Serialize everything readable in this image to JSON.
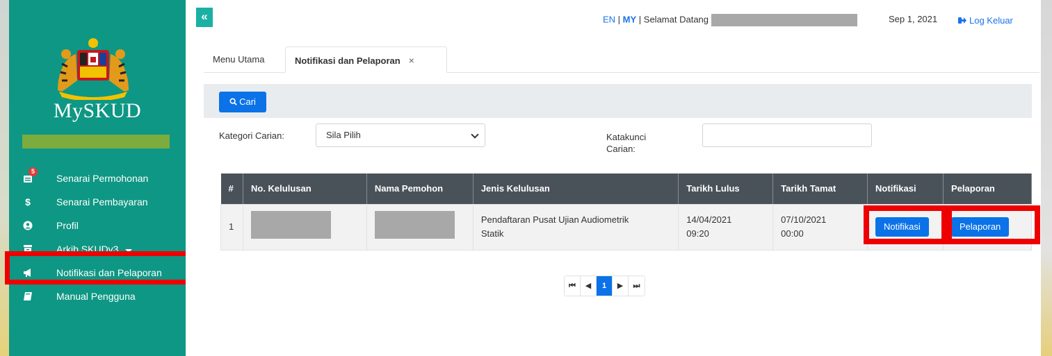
{
  "sidebar": {
    "brand": "MySKUD",
    "menu": [
      {
        "label": "Senarai Permohonan",
        "icon": "inbox-icon",
        "badge": "5"
      },
      {
        "label": "Senarai Pembayaran",
        "icon": "dollar-icon"
      },
      {
        "label": "Profil",
        "icon": "user-circle-icon"
      },
      {
        "label": "Arkib SKUDv3",
        "icon": "archive-icon"
      },
      {
        "label": "Notifikasi dan Pelaporan",
        "icon": "megaphone-icon"
      },
      {
        "label": "Manual Pengguna",
        "icon": "book-icon"
      }
    ]
  },
  "header": {
    "collapse": "«",
    "lang_en": "EN",
    "lang_sep1": " | ",
    "lang_my": "MY",
    "lang_sep2": " |  ",
    "welcome": "Selamat Datang",
    "date": "Sep 1, 2021",
    "logout": "Log Keluar"
  },
  "tabs": [
    {
      "label": "Menu Utama"
    },
    {
      "label": "Notifikasi dan Pelaporan",
      "close": "×"
    }
  ],
  "search": {
    "button": "Cari",
    "category_label": "Kategori Carian:",
    "category_value": "Sila Pilih",
    "keyword_label_1": "Katakunci",
    "keyword_label_2": "Carian:",
    "keyword_value": ""
  },
  "table": {
    "headers": [
      "#",
      "No. Kelulusan",
      "Nama Pemohon",
      "Jenis Kelulusan",
      "Tarikh Lulus",
      "Tarikh Tamat",
      "Notifikasi",
      "Pelaporan"
    ],
    "rows": [
      {
        "no": "1",
        "jenis_1": "Pendaftaran Pusat Ujian Audiometrik",
        "jenis_2": "Statik",
        "lulus_date": "14/04/2021",
        "lulus_time": "09:20",
        "tamat_date": "07/10/2021",
        "tamat_time": "00:00",
        "notifikasi": "Notifikasi",
        "pelaporan": "Pelaporan"
      }
    ]
  },
  "pager": {
    "first": "⏮",
    "prev": "◀",
    "current": "1",
    "next": "▶",
    "last": "⏭"
  },
  "colors": {
    "sidebar": "#0e9784",
    "accent": "#0b72e8",
    "highlight": "#ef0000",
    "table_header": "#4a5259"
  }
}
